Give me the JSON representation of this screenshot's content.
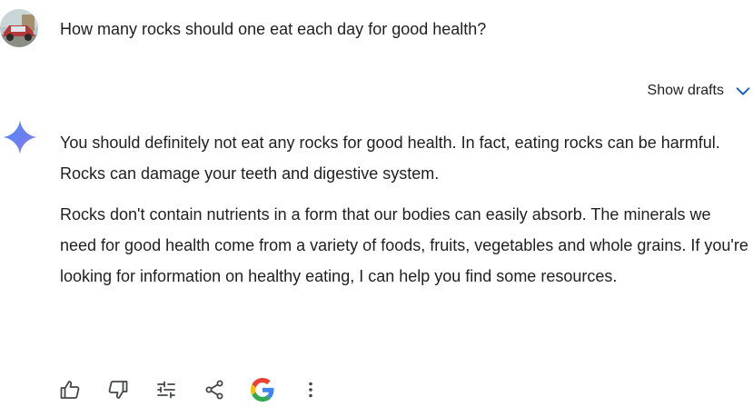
{
  "user_message": {
    "text": "How many rocks should one eat each day for good health?"
  },
  "drafts": {
    "label": "Show drafts"
  },
  "response": {
    "paragraphs": [
      "You should definitely not eat any rocks for good health.  In fact, eating rocks can be harmful.  Rocks can damage your teeth and digestive system.",
      "Rocks don't contain nutrients in a form that our bodies can easily absorb. The minerals we need for good health come from a variety of foods, fruits, vegetables and whole grains.  If you're looking for information on healthy eating, I can help you find some resources."
    ]
  },
  "actions": [
    {
      "icon": "thumbs-up-icon"
    },
    {
      "icon": "thumbs-down-icon"
    },
    {
      "icon": "tune-icon"
    },
    {
      "icon": "share-icon"
    },
    {
      "icon": "google-g-icon"
    },
    {
      "icon": "more-vert-icon"
    }
  ],
  "colors": {
    "text": "#1f1f1f",
    "icon": "#444746",
    "chevron": "#0b57d0",
    "google_blue": "#4285F4",
    "google_red": "#EA4335",
    "google_yellow": "#FBBC05",
    "google_green": "#34A853"
  }
}
